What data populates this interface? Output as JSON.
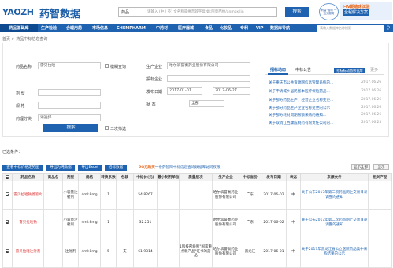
{
  "header": {
    "logo_text": "YAOZH",
    "logo_cn": "药智数据",
    "search_select": "药品",
    "search_placeholder": "请输入 (中 | 英) 文名称或拼音首字母   如:阿莫西林/anmoxilin",
    "search_button": "搜索",
    "promo_logo_text": "药智·国药 一站式服务",
    "promo_line1": "I-IV期临床试验",
    "promo_line2": "全程解决方案"
  },
  "nav": {
    "items": [
      "药品基础库",
      "生产检验",
      "合理用药",
      "市场信息",
      "CHEMPHARM",
      "中药材",
      "医疗器械",
      "食品",
      "化妆品",
      "专利",
      "VIP",
      "数据库导航"
    ],
    "search_placeholder": "请输入数据库名称搜索",
    "search_icon": "search-icon"
  },
  "breadcrumb": "首页 > 药品中标信息查询",
  "form": {
    "drug_name_label": "药品名称",
    "drug_name_value": "雷贝拉唑",
    "fuzzy_label": "模糊查询",
    "dosage_label": "剂    型",
    "spec_label": "规    格",
    "category_label": "药理分类",
    "category_value": "请选择",
    "search_button": "搜索",
    "secondary_label": "二次筛选",
    "producer_label": "生产企业",
    "producer_value": "哈尔滨誉衡药业股份有限公司",
    "bid_company_label": "投标企业",
    "province_label": "省    份",
    "publish_date_label": "发布日期",
    "date_from": "2017-01-01",
    "date_sep": "—",
    "date_to": "2017-06-27",
    "status_label": "状    态",
    "status_value": "全部"
  },
  "news": {
    "tabs": [
      "招标动态",
      "中标公告"
    ],
    "active_tab": 0,
    "tag_label": "招标标动态数据库",
    "more": "更多",
    "items": [
      {
        "title": "关于重庆市公共资源网信息管理系统的...",
        "date": "2017.06.26"
      },
      {
        "title": "关于申请城乡居民基本医疗保险药品...",
        "date": "2017.06.26"
      },
      {
        "title": "关于部分药品生产、经营企业名称变更...",
        "date": "2017.06.26"
      },
      {
        "title": "关于部分药品生产企业名称变更的公示",
        "date": "2017.06.26"
      },
      {
        "title": "关于部分耗材周期限额采购的通知...",
        "date": "2017.06.26"
      },
      {
        "title": "关于取消江西康成制药有限责任公司的...",
        "date": "2017.06.23"
      }
    ]
  },
  "result_text": "已选条件：",
  "toolbar": {
    "buttons": [
      "查看中标价格走势图",
      "导出为纯数据",
      "导出Excel",
      "招标数据"
    ],
    "tip_prefix": "5G元购买",
    "tip_body": "一条药智网中标信息查询数据库访问权限",
    "right_buttons": [
      "显示全部",
      "显示"
    ]
  },
  "table": {
    "headers": [
      "",
      "药品名称",
      "商品名",
      "剂型",
      "规格",
      "转换系数",
      "包装",
      "中标价(元)",
      "最小制剂单位价格",
      "质量层次",
      "生产企业",
      "中标省份",
      "发布日期",
      "状态",
      "来源文件",
      "相关产品"
    ],
    "rows": [
      {
        "name": "雷贝拉唑钠肠溶片",
        "trade": "",
        "form": "小容量注射剂",
        "spec": "4ml:8mg",
        "coef": "1",
        "pack": "",
        "price": "54.8267",
        "unit": "",
        "quality": "",
        "company": "哈尔滨誉衡药业股份有限公司",
        "province": "广东",
        "date": "2017-06-02",
        "status": "中",
        "source": "关于公布2017年第三次药品网上交易目录调整的通知",
        "related": ""
      },
      {
        "name": "雷贝拉唑钠",
        "trade": "",
        "form": "小容量注射剂",
        "spec": "4ml:8mg",
        "coef": "1",
        "pack": "",
        "price": "32.251",
        "unit": "",
        "quality": "",
        "company": "哈尔滨誉衡药业股份有限公司",
        "province": "广东",
        "date": "2017-06-02",
        "status": "中",
        "source": "关于公布2017年第二次药品网上交易目录调整的通知",
        "related": ""
      },
      {
        "name": "雷贝拉唑注射剂",
        "trade": "",
        "form": "注射剂",
        "spec": "4ml:8mg",
        "coef": "5",
        "pack": "支",
        "price": "61.9314",
        "unit": "",
        "quality": "1科技部级别\"国家重点新产品\"证书的药品",
        "company": "哈尔滨誉衡药业股份有限公司",
        "province": "黑龙江",
        "date": "2017-06-01",
        "status": "中",
        "source": "关于2017年黑龙江省公立医院药品集中采购结果的公示",
        "related": ""
      }
    ]
  }
}
